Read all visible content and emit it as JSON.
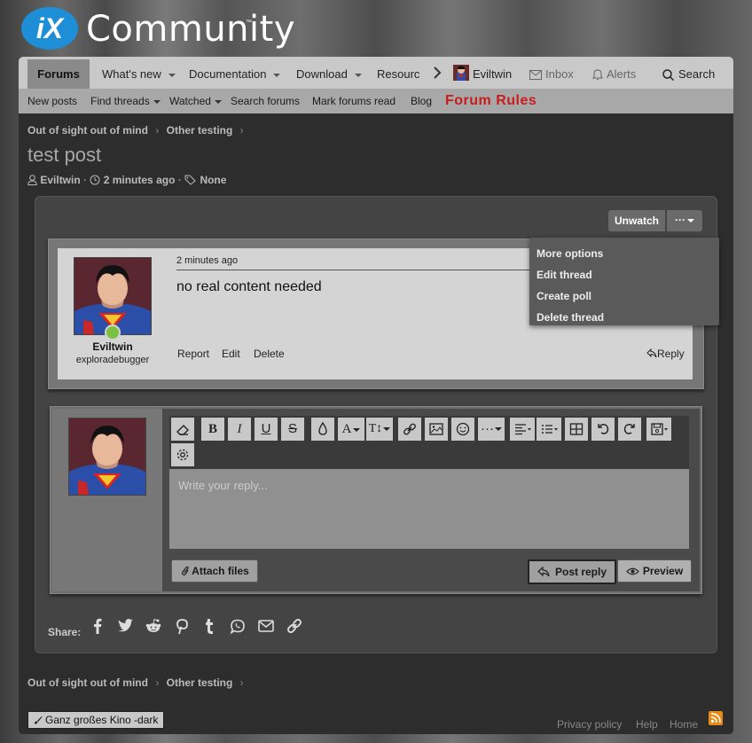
{
  "logo": {
    "badge": "iX",
    "name": "Community",
    "tm": "™"
  },
  "nav": {
    "items": [
      {
        "label": "Forums",
        "active": true
      },
      {
        "label": "What's new",
        "caret": true
      },
      {
        "label": "Documentation",
        "caret": true
      },
      {
        "label": "Download",
        "caret": true
      },
      {
        "label": "Resourc"
      }
    ],
    "user": "Eviltwin",
    "inbox": "Inbox",
    "alerts": "Alerts",
    "search": "Search"
  },
  "subnav": {
    "items": [
      "New posts",
      "Find threads",
      "Watched",
      "Search forums",
      "Mark forums read",
      "Blog"
    ],
    "rules": "Forum Rules"
  },
  "breadcrumb": [
    "Out of sight out of mind",
    "Other testing"
  ],
  "thread": {
    "title": "test post",
    "author": "Eviltwin",
    "time": "2 minutes ago",
    "tags": "None",
    "unwatch": "Unwatch",
    "more_glyph": "···"
  },
  "dropdown": [
    "More options",
    "Edit thread",
    "Create poll",
    "Delete thread"
  ],
  "post": {
    "username": "Eviltwin",
    "user_title": "exploradebugger",
    "time": "2 minutes ago",
    "content": "no real content needed",
    "actions": [
      "Report",
      "Edit",
      "Delete"
    ],
    "reply": "Reply"
  },
  "editor": {
    "placeholder": "Write your reply...",
    "attach": "Attach files",
    "post_reply": "Post reply",
    "preview": "Preview"
  },
  "share": {
    "label": "Share:"
  },
  "footer": {
    "style": "Ganz großes Kino -dark",
    "links": [
      "Privacy policy",
      "Help",
      "Home"
    ]
  },
  "colors": {
    "rules_red": "#c81c1c",
    "logo_blue": "#1e8fd6",
    "rss_orange": "#e98a16"
  }
}
